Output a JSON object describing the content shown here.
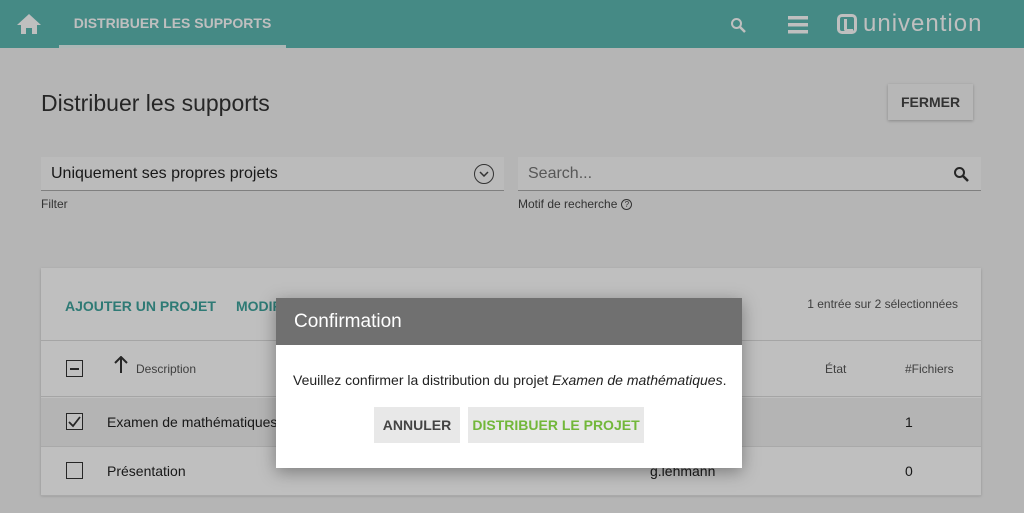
{
  "topbar": {
    "tab_label": "DISTRIBUER LES SUPPORTS",
    "logo_text": "univention",
    "color": "#5cb8b2"
  },
  "page": {
    "title": "Distribuer les supports",
    "close_label": "FERMER"
  },
  "filter": {
    "value": "Uniquement ses propres projets",
    "label": "Filter"
  },
  "search": {
    "placeholder": "Search...",
    "label": "Motif de recherche"
  },
  "grid": {
    "add_project": "AJOUTER UN PROJET",
    "modify": "MODIF",
    "selection_count": "1 entrée sur 2 sélectionnées",
    "columns": {
      "description": "Description",
      "state": "État",
      "files": "#Fichiers"
    },
    "rows": [
      {
        "description": "Examen de mathématiques",
        "owner": "",
        "files": "1",
        "selected": true
      },
      {
        "description": "Présentation",
        "owner": "g.lehmann",
        "files": "0",
        "selected": false
      }
    ]
  },
  "dialog": {
    "title": "Confirmation",
    "message_prefix": "Veuillez confirmer la distribution du projet ",
    "message_project": "Examen de mathématiques",
    "message_suffix": ".",
    "cancel_label": "ANNULER",
    "confirm_label": "DISTRIBUER LE PROJET",
    "confirm_color": "#72b73a"
  },
  "icons": {
    "home": "home-icon",
    "search": "search-icon",
    "menu": "menu-icon",
    "chevron": "chevron-down-icon",
    "sort": "arrow-up-icon",
    "help": "help-icon"
  }
}
